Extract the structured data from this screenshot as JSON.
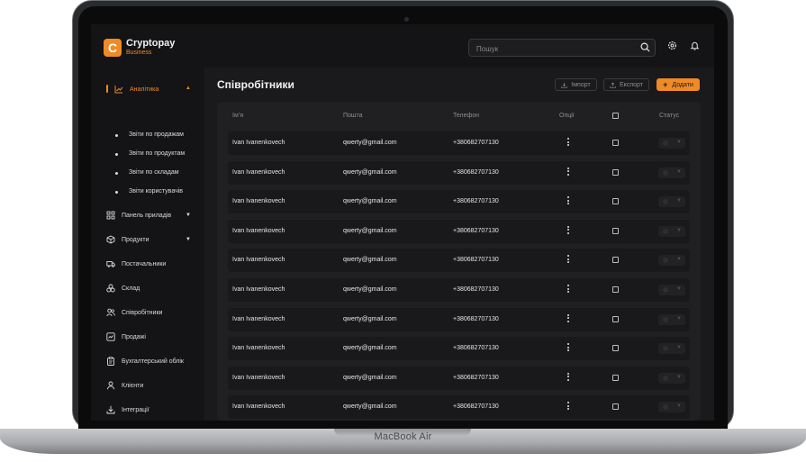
{
  "device_label": "MacBook Air",
  "app": {
    "name": "Cryptopay",
    "subtitle": "Business",
    "logo_letter": "C"
  },
  "header": {
    "search_placeholder": "Пошук"
  },
  "sidebar": {
    "items": [
      {
        "label": "Аналітика",
        "icon": "chart-icon",
        "active": true,
        "expanded": true
      },
      {
        "label": "Панель приладів",
        "icon": "dashboard-icon",
        "caret": true
      },
      {
        "label": "Продукти",
        "icon": "box-icon",
        "caret": true
      },
      {
        "label": "Постачальники",
        "icon": "truck-icon"
      },
      {
        "label": "Склад",
        "icon": "warehouse-icon"
      },
      {
        "label": "Співробітники",
        "icon": "users-icon"
      },
      {
        "label": "Продажі",
        "icon": "sales-icon"
      },
      {
        "label": "Бухгалтерський облік",
        "icon": "clipboard-icon"
      },
      {
        "label": "Клієнти",
        "icon": "user-icon"
      },
      {
        "label": "Інтеграції",
        "icon": "download-icon"
      }
    ],
    "sub_items": [
      "Звіти по продажам",
      "Звіти по продуктам",
      "Звіти по складам",
      "Звіти користувачів"
    ]
  },
  "main": {
    "title": "Співробітники",
    "import_label": "Імпорт",
    "export_label": "Експорт",
    "add_label": "Додати",
    "columns": [
      "Ім’я",
      "Пошта",
      "Телефон",
      "Опції",
      "Статус"
    ],
    "rows": [
      {
        "name": "Ivan Ivanenkovech",
        "email": "qwerty@gmail.com",
        "phone": "+380682707130"
      },
      {
        "name": "Ivan Ivanenkovech",
        "email": "qwerty@gmail.com",
        "phone": "+380682707130"
      },
      {
        "name": "Ivan Ivanenkovech",
        "email": "qwerty@gmail.com",
        "phone": "+380682707130"
      },
      {
        "name": "Ivan Ivanenkovech",
        "email": "qwerty@gmail.com",
        "phone": "+380682707130"
      },
      {
        "name": "Ivan Ivanenkovech",
        "email": "qwerty@gmail.com",
        "phone": "+380682707130"
      },
      {
        "name": "Ivan Ivanenkovech",
        "email": "qwerty@gmail.com",
        "phone": "+380682707130"
      },
      {
        "name": "Ivan Ivanenkovech",
        "email": "qwerty@gmail.com",
        "phone": "+380682707130"
      },
      {
        "name": "Ivan Ivanenkovech",
        "email": "qwerty@gmail.com",
        "phone": "+380682707130"
      },
      {
        "name": "Ivan Ivanenkovech",
        "email": "qwerty@gmail.com",
        "phone": "+380682707130"
      },
      {
        "name": "Ivan Ivanenkovech",
        "email": "qwerty@gmail.com",
        "phone": "+380682707130"
      }
    ]
  },
  "colors": {
    "accent": "#f08a24",
    "background": "#1a1a1c",
    "panel": "#141416"
  }
}
